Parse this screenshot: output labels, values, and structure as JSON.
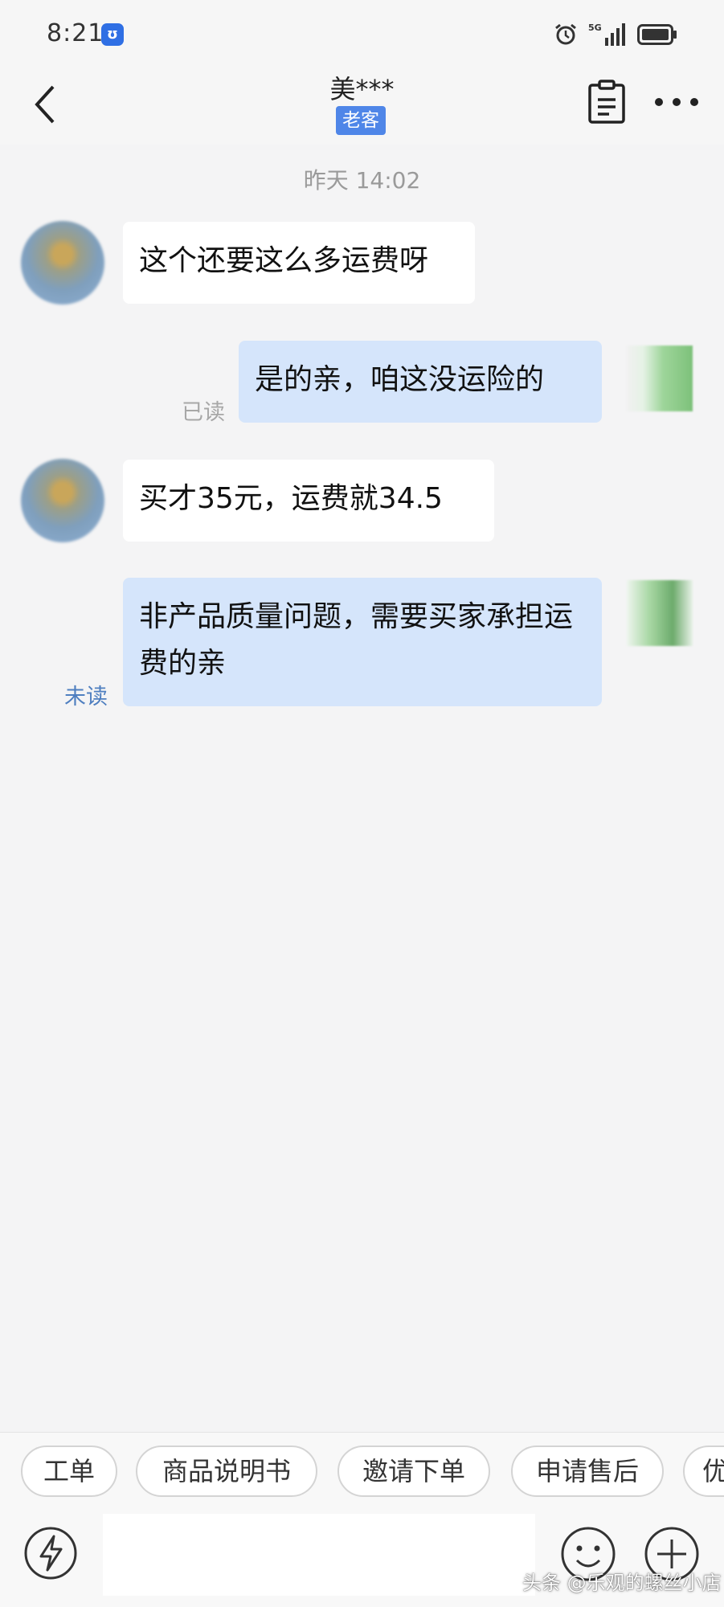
{
  "status_bar": {
    "time": "8:21",
    "app_icon_glyph": "ʊ",
    "network": "5G"
  },
  "header": {
    "title": "美***",
    "badge": "老客"
  },
  "chat": {
    "timestamp": "昨天 14:02",
    "messages": [
      {
        "from": "customer",
        "text": "这个还要这么多运费呀"
      },
      {
        "from": "me",
        "text": "是的亲，咱这没运险的",
        "status": "已读"
      },
      {
        "from": "customer",
        "text": "买才35元，运费就34.5"
      },
      {
        "from": "me",
        "text": "非产品质量问题，需要买家承担运费的亲",
        "status": "未读"
      }
    ]
  },
  "quick_replies": [
    "工单",
    "商品说明书",
    "邀请下单",
    "申请售后",
    "优"
  ],
  "input": {
    "placeholder": ""
  },
  "watermark": "头条 @乐观的螺丝小店",
  "colors": {
    "accent": "#4f86e8",
    "outgoing_bubble": "#d5e5fb",
    "incoming_bubble": "#ffffff",
    "background": "#f4f4f5"
  }
}
